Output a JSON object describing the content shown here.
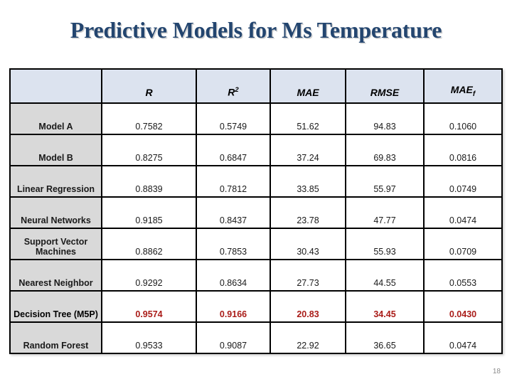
{
  "slide": {
    "title": "Predictive Models for Ms Temperature",
    "page_number": "18",
    "title_color": "#23456f",
    "header_bg": "#dce3ef",
    "label_bg": "#d9d9d9",
    "highlight_color": "#aa1c18"
  },
  "table": {
    "corner_label": "",
    "columns": [
      {
        "label": "R",
        "sup": "",
        "sub": ""
      },
      {
        "label": "R",
        "sup": "2",
        "sub": ""
      },
      {
        "label": "MAE",
        "sup": "",
        "sub": ""
      },
      {
        "label": "RMSE",
        "sup": "",
        "sub": ""
      },
      {
        "label": "MAE",
        "sup": "",
        "sub": "f"
      }
    ],
    "rows": [
      {
        "label": "Model A",
        "R": "0.7582",
        "R2": "0.5749",
        "MAE": "51.62",
        "RMSE": "94.83",
        "MAEf": "0.1060",
        "highlight": false
      },
      {
        "label": "Model B",
        "R": "0.8275",
        "R2": "0.6847",
        "MAE": "37.24",
        "RMSE": "69.83",
        "MAEf": "0.0816",
        "highlight": false
      },
      {
        "label": "Linear Regression",
        "R": "0.8839",
        "R2": "0.7812",
        "MAE": "33.85",
        "RMSE": "55.97",
        "MAEf": "0.0749",
        "highlight": false
      },
      {
        "label": "Neural Networks",
        "R": "0.9185",
        "R2": "0.8437",
        "MAE": "23.78",
        "RMSE": "47.77",
        "MAEf": "0.0474",
        "highlight": false
      },
      {
        "label": "Support Vector Machines",
        "R": "0.8862",
        "R2": "0.7853",
        "MAE": "30.43",
        "RMSE": "55.93",
        "MAEf": "0.0709",
        "highlight": false
      },
      {
        "label": "Nearest Neighbor",
        "R": "0.9292",
        "R2": "0.8634",
        "MAE": "27.73",
        "RMSE": "44.55",
        "MAEf": "0.0553",
        "highlight": false
      },
      {
        "label": "Decision Tree (M5P)",
        "R": "0.9574",
        "R2": "0.9166",
        "MAE": "20.83",
        "RMSE": "34.45",
        "MAEf": "0.0430",
        "highlight": true
      },
      {
        "label": "Random Forest",
        "R": "0.9533",
        "R2": "0.9087",
        "MAE": "22.92",
        "RMSE": "36.65",
        "MAEf": "0.0474",
        "highlight": false
      }
    ]
  },
  "chart_data": {
    "type": "table",
    "title": "Predictive Models for Ms Temperature",
    "columns": [
      "Model",
      "R",
      "R2",
      "MAE",
      "RMSE",
      "MAEf"
    ],
    "rows": [
      [
        "Model A",
        0.7582,
        0.5749,
        51.62,
        94.83,
        0.106
      ],
      [
        "Model B",
        0.8275,
        0.6847,
        37.24,
        69.83,
        0.0816
      ],
      [
        "Linear Regression",
        0.8839,
        0.7812,
        33.85,
        55.97,
        0.0749
      ],
      [
        "Neural Networks",
        0.9185,
        0.8437,
        23.78,
        47.77,
        0.0474
      ],
      [
        "Support Vector Machines",
        0.8862,
        0.7853,
        30.43,
        55.93,
        0.0709
      ],
      [
        "Nearest Neighbor",
        0.9292,
        0.8634,
        27.73,
        44.55,
        0.0553
      ],
      [
        "Decision Tree (M5P)",
        0.9574,
        0.9166,
        20.83,
        34.45,
        0.043
      ],
      [
        "Random Forest",
        0.9533,
        0.9087,
        22.92,
        36.65,
        0.0474
      ]
    ],
    "highlighted_row": "Decision Tree (M5P)",
    "notes": "Best-performing model row rendered in bold dark red"
  }
}
